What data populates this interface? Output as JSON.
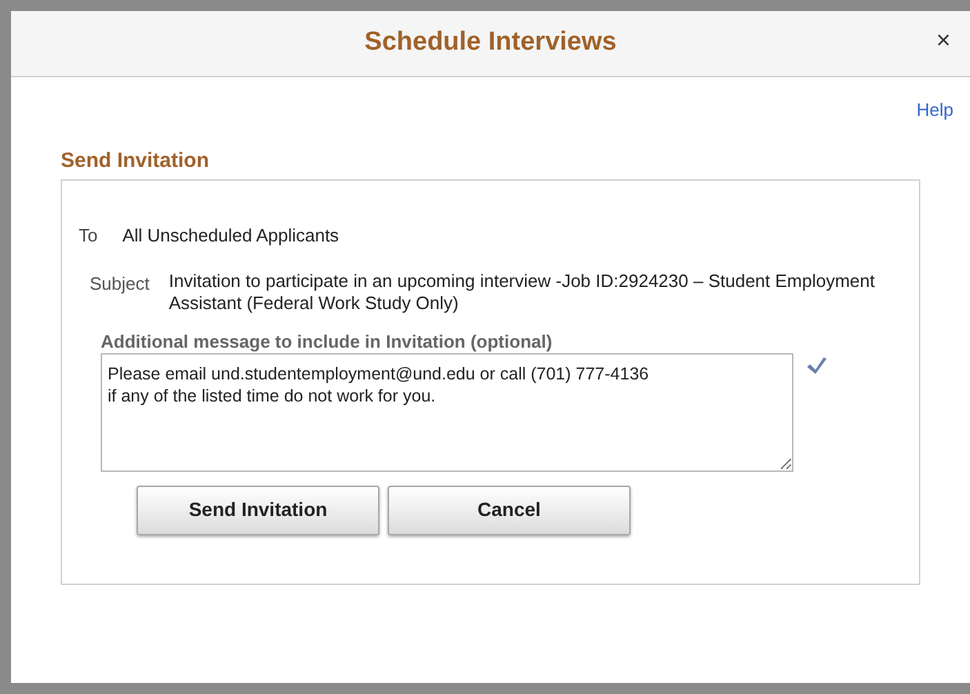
{
  "dialog": {
    "title": "Schedule Interviews",
    "close": "×",
    "help": "Help"
  },
  "section": {
    "title": "Send Invitation"
  },
  "to": {
    "label": "To",
    "value": "All Unscheduled Applicants"
  },
  "subject": {
    "label": "Subject",
    "value": "Invitation to participate in an upcoming interview -Job ID:2924230 – Student Employment Assistant (Federal Work Study Only)"
  },
  "message": {
    "label": "Additional message to include in Invitation (optional)",
    "value": "Please email und.studentemployment@und.edu or call (701) 777-4136\nif any of the listed time do not work for you."
  },
  "buttons": [
    {
      "label": "Send Invitation"
    },
    {
      "label": "Cancel"
    }
  ]
}
